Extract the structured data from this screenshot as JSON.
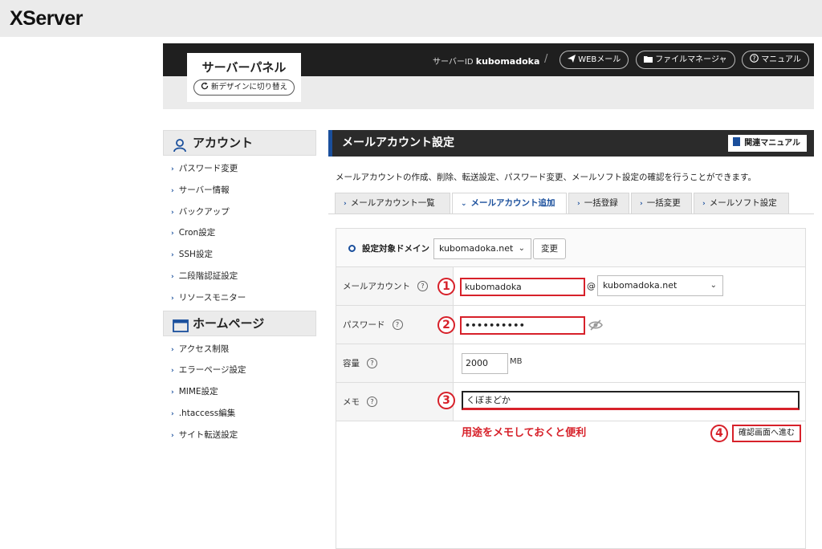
{
  "brand": {
    "logo": "XServer"
  },
  "header": {
    "panel_title": "サーバーパネル",
    "redesign_label": "新デザインに切り替え",
    "server_id_label": "サーバーID",
    "server_id_value": "kubomadoka",
    "separator": "/",
    "buttons": [
      {
        "label": "WEBメール",
        "icon": "paper-plane-icon"
      },
      {
        "label": "ファイルマネージャ",
        "icon": "folder-icon"
      },
      {
        "label": "マニュアル",
        "icon": "question-circle-icon"
      }
    ]
  },
  "sidebar": {
    "sections": [
      {
        "title": "アカウント",
        "icon": "user-icon",
        "items": [
          "パスワード変更",
          "サーバー情報",
          "バックアップ",
          "Cron設定",
          "SSH設定",
          "二段階認証設定",
          "リソースモニター"
        ]
      },
      {
        "title": "ホームページ",
        "icon": "browser-window-icon",
        "items": [
          "アクセス制限",
          "エラーページ設定",
          "MIME設定",
          ".htaccess編集",
          "サイト転送設定"
        ]
      }
    ]
  },
  "main": {
    "title": "メールアカウント設定",
    "manual_label": "関連マニュアル",
    "description": "メールアカウントの作成、削除、転送設定、パスワード変更、メールソフト設定の確認を行うことができます。",
    "tabs": [
      {
        "label": "メールアカウント一覧",
        "active": false
      },
      {
        "label": "メールアカウント追加",
        "active": true
      },
      {
        "label": "一括登録",
        "active": false
      },
      {
        "label": "一括変更",
        "active": false
      },
      {
        "label": "メールソフト設定",
        "active": false
      }
    ],
    "domain_row": {
      "label": "設定対象ドメイン",
      "selected": "kubomadoka.net",
      "change_label": "変更"
    },
    "form": {
      "account": {
        "label": "メールアカウント",
        "value": "kubomadoka",
        "at": "@",
        "domain": "kubomadoka.net"
      },
      "password": {
        "label": "パスワード",
        "value": "••••••••••"
      },
      "capacity": {
        "label": "容量",
        "value": "2000",
        "unit": "MB"
      },
      "memo": {
        "label": "メモ",
        "value": "くぼまどか"
      }
    },
    "help_glyph": "?",
    "annotations": {
      "n1": "1",
      "n2": "2",
      "n3": "3",
      "n4": "4",
      "memo_note": "用途をメモしておくと便利",
      "confirm_label": "確認画面へ進む"
    },
    "accent_color": "#1a4f9c",
    "highlight_color": "#d7212a"
  }
}
